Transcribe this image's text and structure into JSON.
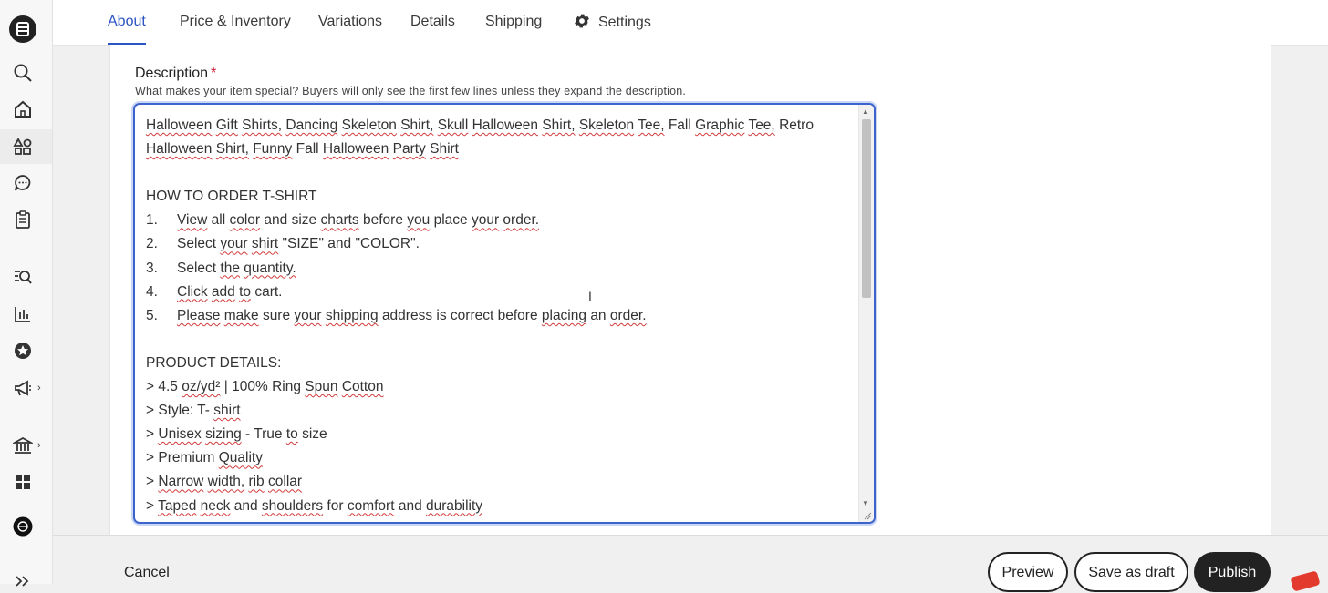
{
  "nav_rail": {
    "icons": [
      "etsy-logo-icon",
      "search-icon",
      "home-icon",
      "listings-icon",
      "messages-icon",
      "orders-icon",
      "marketing-search-icon",
      "stats-icon",
      "star-seller-icon",
      "megaphone-icon",
      "bank-icon",
      "apps-icon",
      "profile-icon",
      "expand-icon"
    ]
  },
  "tabs": [
    {
      "label": "About",
      "active": true
    },
    {
      "label": "Price & Inventory"
    },
    {
      "label": "Variations"
    },
    {
      "label": "Details"
    },
    {
      "label": "Shipping"
    },
    {
      "label": "Settings"
    }
  ],
  "description": {
    "label": "Description",
    "required_mark": "*",
    "help": "What makes your item special? Buyers will only see the first few lines unless they expand the description.",
    "lines": [
      "Halloween Gift Shirts, Dancing Skeleton Shirt, Skull Halloween Shirt, Skeleton Tee, Fall Graphic Tee, Retro",
      "Halloween Shirt, Funny Fall Halloween Party Shirt",
      "",
      "HOW TO ORDER T-SHIRT",
      {
        "num": "1.",
        "text": "View all color and size charts before you place your order."
      },
      {
        "num": "2.",
        "text": "Select your shirt \"SIZE\" and \"COLOR\"."
      },
      {
        "num": "3.",
        "text": "Select the quantity."
      },
      {
        "num": "4.",
        "text": "Click add to cart."
      },
      {
        "num": "5.",
        "text": "Please make sure your shipping address is correct before placing an order."
      },
      "",
      "PRODUCT DETAILS:",
      "> 4.5 oz/yd² | 100% Ring Spun Cotton",
      "> Style: T- shirt",
      "> Unisex sizing - True to size",
      "> Premium Quality",
      "> Narrow width, rib collar",
      "> Taped neck and shoulders for comfort and durability"
    ]
  },
  "footer": {
    "cancel": "Cancel",
    "preview": "Preview",
    "save_draft": "Save as draft",
    "publish": "Publish"
  },
  "colors": {
    "accent": "#2b54c4",
    "publish_bg": "#222222",
    "required": "#c8102e"
  }
}
